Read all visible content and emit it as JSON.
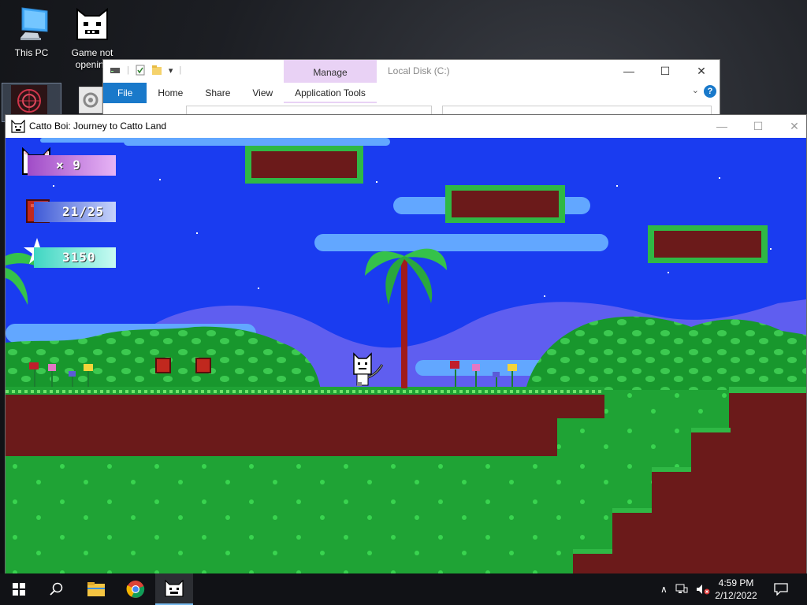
{
  "desktop": {
    "icons": [
      {
        "label": "This PC"
      },
      {
        "label": "Game not opening"
      }
    ]
  },
  "explorer": {
    "title": "Local Disk (C:)",
    "manage_label": "Manage",
    "application_tools_label": "Application Tools",
    "ribbon_tabs": [
      "File",
      "Home",
      "Share",
      "View"
    ],
    "window_controls": {
      "minimize": "—",
      "maximize": "☐",
      "close": "✕"
    },
    "help_label": "?",
    "collapse_label": "⌄"
  },
  "game_window": {
    "title": "Catto Boi: Journey to Catto Land",
    "controls": {
      "minimize": "—",
      "maximize": "☐",
      "close": "✕"
    }
  },
  "hud": {
    "lives": "× 9",
    "blocks": "21/25",
    "score": "3150"
  },
  "taskbar": {
    "apps": [
      "start-icon",
      "search-icon",
      "file-explorer-icon",
      "chrome-icon",
      "catto-game-icon"
    ],
    "clock": {
      "time": "4:59 PM",
      "date": "2/12/2022"
    }
  },
  "colors": {
    "sky": "#1a3cf0",
    "ground_dirt": "#6b1a1a",
    "grass": "#1fa335",
    "bush": "#2fb34a",
    "hud_lives": "#c77ad9",
    "hud_blocks": "#8aa6f2",
    "hud_score": "#8ef2e0"
  }
}
